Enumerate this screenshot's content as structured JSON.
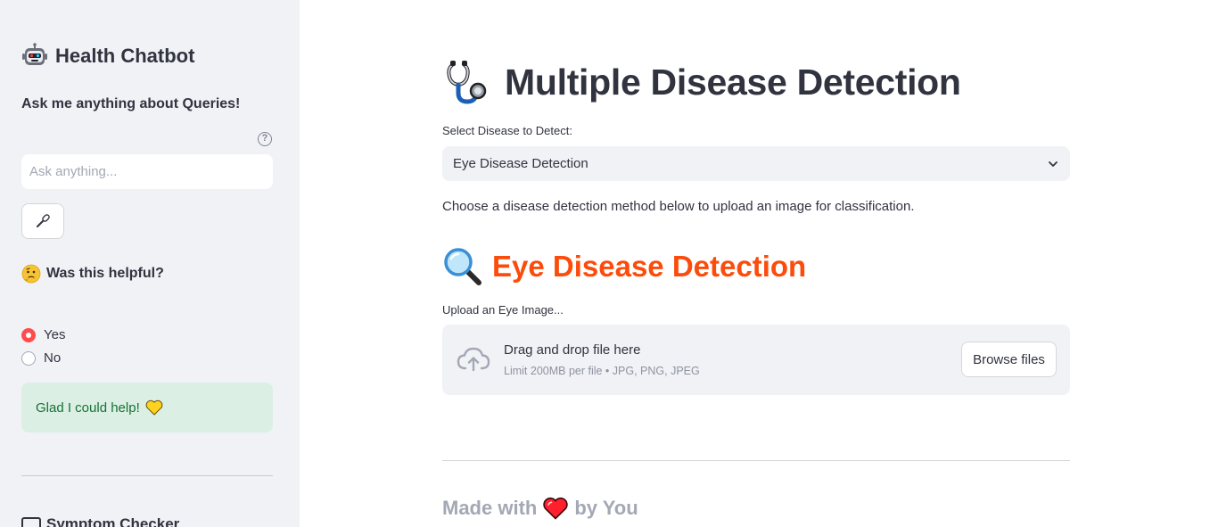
{
  "sidebar": {
    "title": "Health Chatbot",
    "subtitle": "Ask me anything about Queries!",
    "ask_placeholder": "Ask anything...",
    "helpful_question": "Was this helpful?",
    "feedback_options": [
      {
        "label": "Yes",
        "selected": true
      },
      {
        "label": "No",
        "selected": false
      }
    ],
    "success_message": "Glad I could help!",
    "next_section_title": "Symptom Checker"
  },
  "main": {
    "title": "Multiple Disease Detection",
    "select_label": "Select Disease to Detect:",
    "select_value": "Eye Disease Detection",
    "description": "Choose a disease detection method below to upload an image for classification.",
    "section_title": "Eye Disease Detection",
    "upload_label": "Upload an Eye Image...",
    "dropzone_text": "Drag and drop file here",
    "dropzone_limit": "Limit 200MB per file • JPG, PNG, JPEG",
    "browse_label": "Browse files",
    "footer_prefix": "Made with",
    "footer_suffix": "by You"
  },
  "colors": {
    "accent": "#ff4b4b",
    "section_title": "#fc4c0c",
    "success_bg": "#dbefe4",
    "success_text": "#177233",
    "sidebar_bg": "#f0f2f6"
  },
  "icons": [
    "robot-icon",
    "help-icon",
    "microphone-icon",
    "thinking-face-icon",
    "yellow-heart-icon",
    "keyboard-icon",
    "stethoscope-icon",
    "chevron-down-icon",
    "magnifier-icon",
    "cloud-upload-icon",
    "red-heart-icon"
  ]
}
